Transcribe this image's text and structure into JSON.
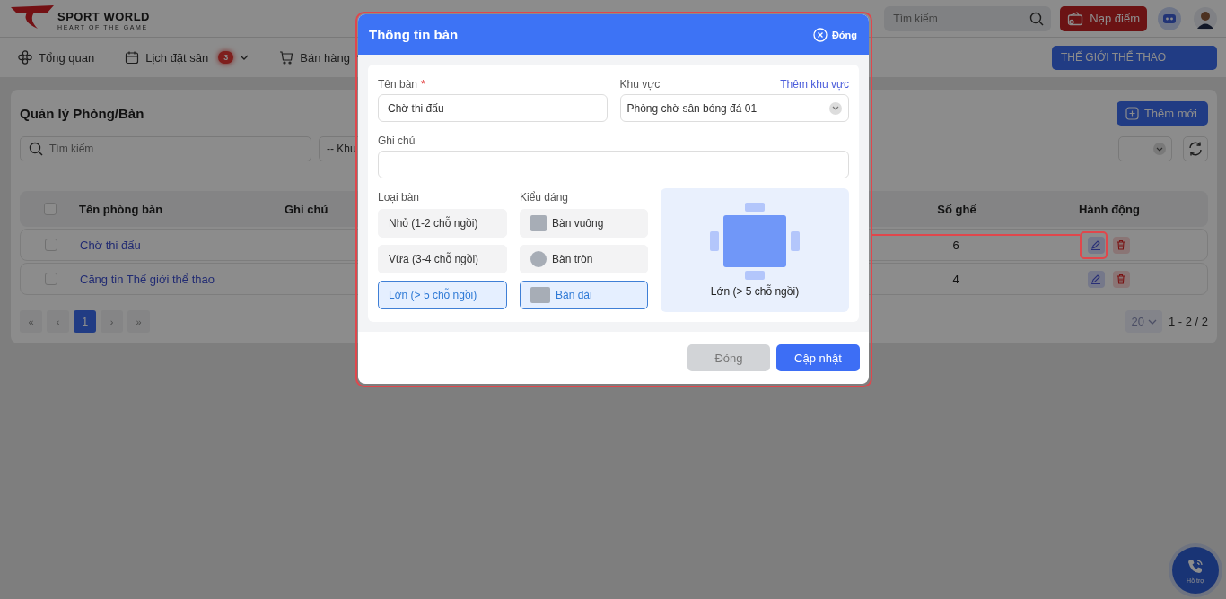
{
  "header": {
    "logo_title": "SPORT WORLD",
    "logo_tagline": "HEART OF THE GAME",
    "search": {
      "placeholder": "Tìm kiếm"
    },
    "topup_button": "Nạp điểm"
  },
  "nav": {
    "items": [
      {
        "label": "Tổng quan",
        "dropdown": false
      },
      {
        "label": "Lịch đặt sân",
        "badge": "3",
        "dropdown": true
      },
      {
        "label": "Bán hàng",
        "dropdown": true
      }
    ],
    "branch_button": "THẾ GIỚI THỂ THAO"
  },
  "page": {
    "title": "Quản lý Phòng/Bàn",
    "add_button": "Thêm mới",
    "search": {
      "placeholder": "Tìm kiếm"
    },
    "area_filter": "-- Khu"
  },
  "table": {
    "columns": [
      "Tên phòng bàn",
      "Ghi chú",
      "Số ghế",
      "Hành động"
    ],
    "header_checked": false,
    "rows": [
      {
        "name": "Chờ thi đấu",
        "seats": "6",
        "checked": false
      },
      {
        "name": "Căng tin Thế giới thể thao",
        "seats": "4",
        "checked": false
      }
    ]
  },
  "pagination": {
    "first": "«",
    "prev": "‹",
    "pages": [
      {
        "label": "1",
        "selected": true
      }
    ],
    "next": "›",
    "last": "»",
    "page_size": "20",
    "range": "1 - 2 / 2"
  },
  "support_button": "Hỗ trợ",
  "modal": {
    "title": "Thông tin bàn",
    "close_label": "Đóng",
    "name_field": {
      "label": "Tên bàn",
      "required_mark": "*",
      "value": "Chờ thi đấu"
    },
    "area_field": {
      "label": "Khu vực",
      "link": "Thêm khu vực",
      "value": "Phòng chờ sân bóng đá 01"
    },
    "note_field": {
      "label": "Ghi chú"
    },
    "size_group": {
      "label": "Loại bàn",
      "options": [
        {
          "label": "Nhỏ (1-2 chỗ ngồi)",
          "selected": false
        },
        {
          "label": "Vừa (3-4 chỗ ngồi)",
          "selected": false
        },
        {
          "label": "Lớn (> 5 chỗ ngồi)",
          "selected": true
        }
      ]
    },
    "shape_group": {
      "label": "Kiểu dáng",
      "options": [
        {
          "label": "Bàn vuông",
          "kind": "square",
          "selected": false
        },
        {
          "label": "Bàn tròn",
          "kind": "round",
          "selected": false
        },
        {
          "label": "Bàn dài",
          "kind": "long",
          "selected": true
        }
      ]
    },
    "preview_caption": "Lớn (> 5 chỗ ngồi)",
    "cancel_button": "Đóng",
    "submit_button": "Cập nhật"
  }
}
